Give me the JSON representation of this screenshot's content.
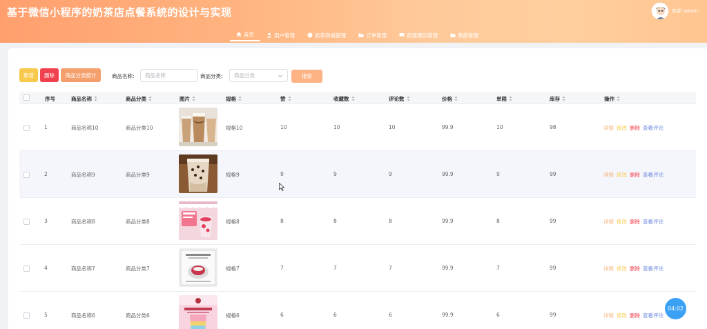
{
  "header": {
    "title": "基于微信小程序的奶茶店点餐系统的设计与实现",
    "welcome": "欢迎 admin"
  },
  "nav": [
    {
      "label": "首页",
      "icon": "home-icon"
    },
    {
      "label": "用户管理",
      "icon": "user-icon"
    },
    {
      "label": "奶茶商城管理",
      "icon": "circle-icon"
    },
    {
      "label": "订单管理",
      "icon": "folder-icon"
    },
    {
      "label": "反馈建议管理",
      "icon": "chat-icon"
    },
    {
      "label": "系统管理",
      "icon": "folder-icon"
    }
  ],
  "toolbar": {
    "add_label": "新增",
    "delete_label": "删除",
    "stat_label": "商品分类统计",
    "name_label": "商品名称:",
    "name_placeholder": "商品名称",
    "category_label": "商品分类:",
    "category_placeholder": "商品分类",
    "search_label": "搜索"
  },
  "table": {
    "columns": [
      "序号",
      "商品名称",
      "商品分类",
      "图片",
      "规格",
      "赞",
      "收藏数",
      "评论数",
      "价格",
      "单限",
      "库存",
      "操作"
    ],
    "rows": [
      {
        "no": "1",
        "name": "商品名称10",
        "category": "商品分类10",
        "spec": "规格10",
        "likes": "10",
        "favorites": "10",
        "comments": "10",
        "price": "99.9",
        "limit": "10",
        "stock": "98"
      },
      {
        "no": "2",
        "name": "商品名称9",
        "category": "商品分类9",
        "spec": "规格9",
        "likes": "9",
        "favorites": "9",
        "comments": "9",
        "price": "99.9",
        "limit": "9",
        "stock": "99"
      },
      {
        "no": "3",
        "name": "商品名称8",
        "category": "商品分类8",
        "spec": "规格8",
        "likes": "8",
        "favorites": "8",
        "comments": "8",
        "price": "99.9",
        "limit": "8",
        "stock": "99"
      },
      {
        "no": "4",
        "name": "商品名称7",
        "category": "商品分类7",
        "spec": "规格7",
        "likes": "7",
        "favorites": "7",
        "comments": "7",
        "price": "99.9",
        "limit": "7",
        "stock": "99"
      },
      {
        "no": "5",
        "name": "商品名称6",
        "category": "商品分类6",
        "spec": "规格6",
        "likes": "6",
        "favorites": "6",
        "comments": "6",
        "price": "99.9",
        "limit": "6",
        "stock": "99"
      }
    ],
    "actions": {
      "detail": "详情",
      "edit": "修改",
      "delete": "删除",
      "review": "查看评论"
    }
  },
  "timer": "04:02",
  "colors": {
    "header_start": "#ff9f6e",
    "header_end": "#ffc590",
    "danger": "#f2414e",
    "warning": "#f9c94d",
    "accent": "#f5a06c",
    "link": "#6c8ae0"
  }
}
